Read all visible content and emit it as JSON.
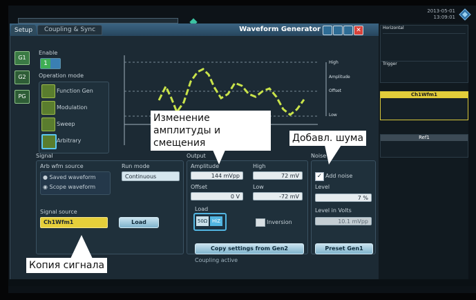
{
  "header": {
    "datetime_line1": "2013-05-01",
    "datetime_line2": "13:09:01"
  },
  "window": {
    "title": "Waveform Generator",
    "tabs": [
      {
        "label": "Setup"
      },
      {
        "label": "Coupling & Sync"
      }
    ],
    "channels": [
      "G1",
      "G2",
      "PG"
    ]
  },
  "enable": {
    "label": "Enable",
    "value": "1"
  },
  "operation_mode": {
    "label": "Operation mode",
    "items": [
      "Function Gen",
      "Modulation",
      "Sweep",
      "Arbitrary"
    ]
  },
  "waveform_preview": {
    "labels": [
      "High",
      "Amplitude",
      "Offset",
      "Low"
    ]
  },
  "signal": {
    "label": "Signal",
    "arb_source_label": "Arb wfm source",
    "arb_sources": [
      "Saved waveform",
      "Scope waveform"
    ],
    "run_mode_label": "Run mode",
    "run_mode_value": "Continuous",
    "signal_source_label": "Signal source",
    "signal_source_value": "Ch1Wfm1",
    "load_button": "Load"
  },
  "output": {
    "label": "Output",
    "amplitude_label": "Amplitude",
    "amplitude_value": "144 mVpp",
    "high_label": "High",
    "high_value": "72 mV",
    "offset_label": "Offset",
    "offset_value": "0 V",
    "low_label": "Low",
    "low_value": "-72 mV",
    "load_label": "Load",
    "load_50": "50Ω",
    "load_hiz": "HiZ",
    "inversion_label": "Inversion",
    "copy_button": "Copy settings from Gen2",
    "coupling_status": "Coupling active"
  },
  "noise": {
    "label": "Noise",
    "add_noise_label": "Add noise",
    "level_label": "Level",
    "level_value": "7 %",
    "level_volts_label": "Level in Volts",
    "level_volts_value": "10.1 mVpp",
    "preset_button": "Preset Gen1"
  },
  "callouts": {
    "amplitude_offset": "Изменение амплитуды и смещения",
    "noise": "Добавл. шума",
    "signal_copy": "Копия сигнала"
  },
  "right_panel": {
    "horizontal_title": "Horizontal",
    "trigger_title": "Trigger",
    "ch1_title": "Ch1Wfm1",
    "ref_title": "Ref1"
  },
  "colors": {
    "waveform": "#c9e34a",
    "accent": "#6fb3d6",
    "enable_green": "#3fae55"
  }
}
